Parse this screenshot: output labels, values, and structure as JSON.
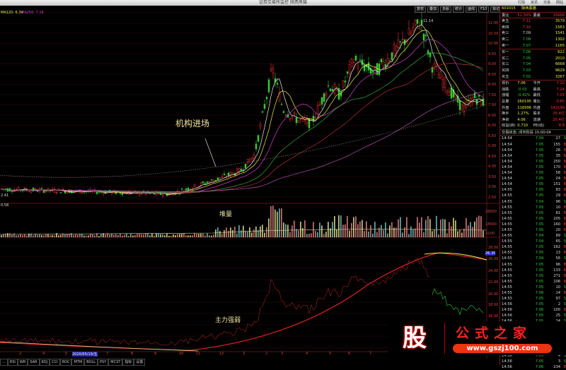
{
  "window": {
    "title": "证券交易所监控 陕西黑猫",
    "controls": [
      "行情",
      "资讯",
      "交易",
      "网站"
    ]
  },
  "toolbar": [
    "复权",
    "叠加",
    "多股",
    "统计",
    "画线",
    "F10",
    "标记",
    "+自选",
    "返回"
  ],
  "chart": {
    "ma_label_1": "MA120: 6.34",
    "ma_label_2": "MA250: 7.16",
    "peak_label": "11.14",
    "low_label": "2.41",
    "volume_low": "0.58",
    "annotation_1": "机构进场",
    "annotation_2": "堆量",
    "annotation_3": "主力强弱",
    "price_axis": [
      "11.00",
      "10.50",
      "10.00",
      "9.50",
      "9.00",
      "8.50",
      "8.00",
      "7.50",
      "7.00",
      "6.50",
      "6.00",
      "5.50",
      "5.00",
      "4.50",
      "4.00",
      "3.50",
      "3.00",
      "2.50"
    ],
    "volume_axis": [
      "28000",
      "18000",
      "X100"
    ],
    "indicator_axis": [
      "28.00",
      "26.00",
      "24.00",
      "22.00",
      "20.00",
      "18.00",
      "16.00"
    ],
    "indicator_current": "26.35",
    "date_axis": [
      "2",
      "4",
      "5",
      "7",
      "8",
      "9",
      "10",
      "11",
      "12",
      "3",
      "2",
      "3",
      "4",
      "5",
      "6",
      "7",
      "8"
    ],
    "date_highlight": "2020/05/19/五"
  },
  "tabs": [
    "...",
    "RSI",
    "WR",
    "SAR",
    "KDJ",
    "CCI",
    "ROC",
    "MTM",
    "BOLL",
    "PSY",
    "MCST",
    "指标",
    "设置"
  ],
  "quote": {
    "code": "601015",
    "name": "陕西黑猫",
    "weibi_label": "委比",
    "weibi": "51.30%",
    "weicha_label": "委差",
    "weicha": "15666",
    "asks": [
      {
        "l": "卖五",
        "p": "7.11",
        "v": "3579"
      },
      {
        "l": "卖四",
        "p": "7.10",
        "v": "1563"
      },
      {
        "l": "卖三",
        "p": "7.09",
        "v": "1541"
      },
      {
        "l": "卖二",
        "p": "7.08",
        "v": "1302"
      },
      {
        "l": "卖一",
        "p": "7.07",
        "v": "1165"
      }
    ],
    "bids": [
      {
        "l": "买一",
        "p": "7.06",
        "v": "622"
      },
      {
        "l": "买二",
        "p": "7.05",
        "v": "2010"
      },
      {
        "l": "买三",
        "p": "7.04",
        "v": "6668"
      },
      {
        "l": "买四",
        "p": "7.03",
        "v": "9629"
      },
      {
        "l": "买五",
        "p": "7.02",
        "v": "3267"
      }
    ],
    "stats": [
      {
        "a": "现价",
        "b": "7.06",
        "c": "今开",
        "d": "7.10"
      },
      {
        "a": "涨跌",
        "b": "-0.03",
        "c": "最高",
        "d": "7.14"
      },
      {
        "a": "涨幅",
        "b": "-0.42%",
        "c": "最低",
        "d": "7.03"
      },
      {
        "a": "总量",
        "b": "260195",
        "c": "量比",
        "d": "0.65"
      },
      {
        "a": "外盘",
        "b": "116996",
        "c": "内盘",
        "d": "143199"
      },
      {
        "a": "换手",
        "b": "1.27%",
        "c": "股本",
        "d": "20.4亿"
      },
      {
        "a": "净资",
        "b": "4.06",
        "c": "流通",
        "d": "20.4亿"
      },
      {
        "a": "收益(四)",
        "b": "0.710",
        "c": "PE(动)",
        "d": "8.8"
      }
    ],
    "status": "交易状态: 闭市阶段 15:00:04",
    "ticks": [
      [
        "14:54",
        "7.04",
        "27",
        "S"
      ],
      [
        "14:54",
        "7.05",
        "155",
        "B"
      ],
      [
        "14:54",
        "7.05",
        "26",
        "B"
      ],
      [
        "14:54",
        "7.05",
        "35",
        "B"
      ],
      [
        "14:54",
        "7.05",
        "250",
        "B"
      ],
      [
        "14:54",
        "7.05",
        "170",
        "B"
      ],
      [
        "14:54",
        "7.05",
        "58",
        "B"
      ],
      [
        "14:54",
        "7.05",
        "24",
        "B"
      ],
      [
        "14:54",
        "7.05",
        "151",
        "B"
      ],
      [
        "14:55",
        "7.05",
        "83",
        "B"
      ],
      [
        "14:55",
        "7.05",
        "29",
        "B"
      ],
      [
        "14:55",
        "7.04",
        "96",
        "S"
      ],
      [
        "14:55",
        "7.05",
        "10",
        "B"
      ],
      [
        "14:55",
        "7.05",
        "81",
        "B"
      ],
      [
        "14:55",
        "7.05",
        "205",
        "B"
      ],
      [
        "14:55",
        "7.05",
        "160",
        "B"
      ],
      [
        "14:55",
        "7.05",
        "20",
        "B"
      ],
      [
        "14:55",
        "7.04",
        "89",
        "S"
      ],
      [
        "14:55",
        "7.04",
        "65",
        "S"
      ],
      [
        "14:55",
        "7.05",
        "162",
        "B"
      ],
      [
        "14:55",
        "7.05",
        "13",
        "B"
      ],
      [
        "14:55",
        "7.04",
        "56",
        "S"
      ],
      [
        "14:55",
        "7.05",
        "96",
        "B"
      ],
      [
        "14:55",
        "7.05",
        "133",
        "B"
      ],
      [
        "14:55",
        "7.05",
        "271",
        "B"
      ],
      [
        "14:55",
        "7.05",
        "106",
        "B"
      ],
      [
        "14:55",
        "7.05",
        "10",
        "S"
      ],
      [
        "14:55",
        "7.06",
        "14",
        "B"
      ],
      [
        "14:55",
        "7.05",
        "97",
        "S"
      ],
      [
        "14:56",
        "7.05",
        "2",
        "S"
      ],
      [
        "14:56",
        "7.06",
        "100",
        "B"
      ],
      [
        "14:56",
        "7.05",
        "25",
        "S"
      ],
      [
        "14:56",
        "7.05",
        "24",
        "S"
      ],
      [
        "14:56",
        "7.05",
        "124",
        "S"
      ],
      [
        "14:56",
        "7.05",
        "29",
        "S"
      ],
      [
        "14:56",
        "7.05",
        "198",
        "S"
      ],
      [
        "14:56",
        "7.06",
        "53",
        "B"
      ],
      [
        "14:56",
        "7.05",
        "159",
        "S"
      ],
      [
        "14:56",
        "7.05",
        "4",
        "S"
      ],
      [
        "14:56",
        "7.05",
        "3",
        "S"
      ],
      [
        "14:56",
        "7.06",
        "234",
        "B"
      ]
    ]
  },
  "watermark": {
    "logo": "股",
    "brand": "公式之家",
    "url": "www.gszj100.com"
  },
  "colors": {
    "up": "#ff3333",
    "down": "#33cc33",
    "grid": "#5a1010",
    "bg": "#000000"
  }
}
